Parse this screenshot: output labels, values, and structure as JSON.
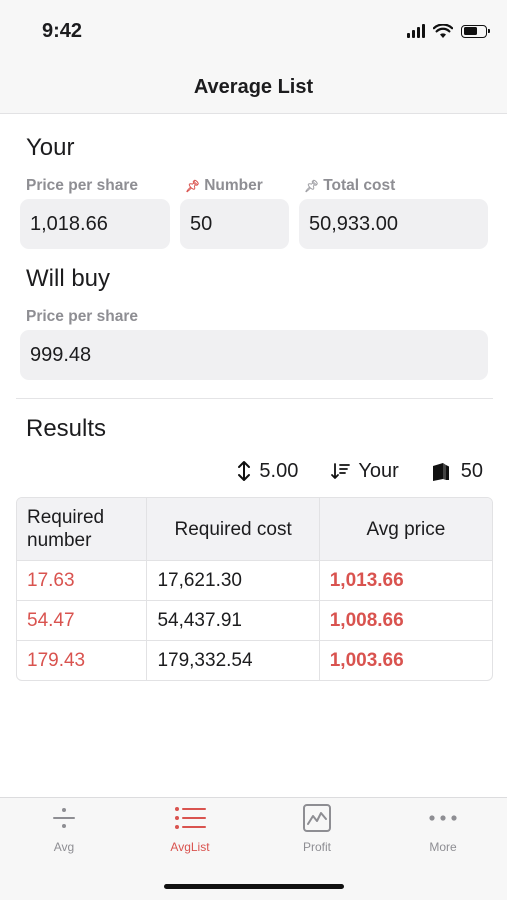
{
  "status_bar": {
    "time": "9:42"
  },
  "nav": {
    "title": "Average List"
  },
  "your": {
    "section_title": "Your",
    "price_label": "Price per share",
    "price_value": "1,018.66",
    "number_label": "Number",
    "number_value": "50",
    "total_label": "Total cost",
    "total_value": "50,933.00"
  },
  "will_buy": {
    "section_title": "Will buy",
    "price_label": "Price per share",
    "price_value": "999.48"
  },
  "results": {
    "section_title": "Results",
    "controls": {
      "step_value": "5.00",
      "sort_label": "Your",
      "count_value": "50"
    },
    "table": {
      "headers": [
        "Required number",
        "Required cost",
        "Avg price"
      ],
      "rows": [
        {
          "number": "17.63",
          "cost": "17,621.30",
          "avg": "1,013.66"
        },
        {
          "number": "54.47",
          "cost": "54,437.91",
          "avg": "1,008.66"
        },
        {
          "number": "179.43",
          "cost": "179,332.54",
          "avg": "1,003.66"
        }
      ]
    }
  },
  "tab_bar": {
    "tabs": [
      {
        "label": "Avg",
        "icon": "divide-icon",
        "active": false
      },
      {
        "label": "AvgList",
        "icon": "list-icon",
        "active": true
      },
      {
        "label": "Profit",
        "icon": "chart-icon",
        "active": false
      },
      {
        "label": "More",
        "icon": "more-icon",
        "active": false
      }
    ]
  },
  "colors": {
    "accent": "#d9534f",
    "field_bg": "#f0f0f2",
    "label_grey": "#8e8e93",
    "bar_bg": "#f7f7f7"
  }
}
